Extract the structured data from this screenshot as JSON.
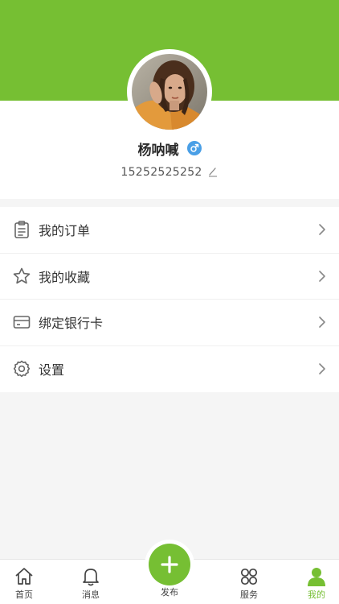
{
  "colors": {
    "brand": "#76bf33",
    "gender_badge": "#4a9fe6"
  },
  "profile": {
    "name": "杨呐喊",
    "gender_icon": "male-symbol-icon",
    "phone": "15252525252",
    "edit_icon": "pencil-icon"
  },
  "menu": {
    "items": [
      {
        "label": "我的订单",
        "icon": "clipboard-icon"
      },
      {
        "label": "我的收藏",
        "icon": "star-icon"
      },
      {
        "label": "绑定银行卡",
        "icon": "credit-card-icon"
      },
      {
        "label": "设置",
        "icon": "gear-icon"
      }
    ]
  },
  "tabbar": {
    "home": "首页",
    "messages": "消息",
    "publish": "发布",
    "services": "服务",
    "mine": "我的",
    "active": "mine"
  }
}
